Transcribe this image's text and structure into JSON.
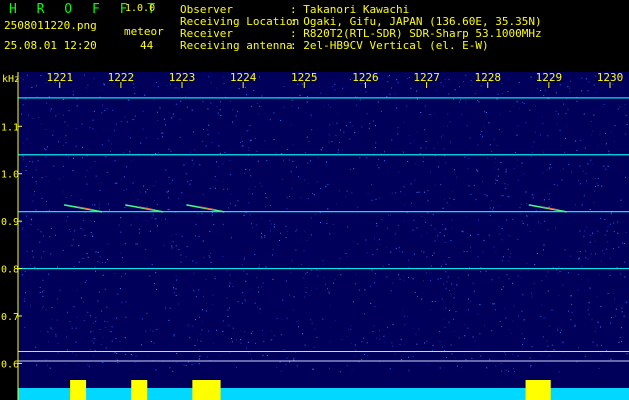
{
  "header": {
    "app_name": "H R O F F T",
    "version": "1.0.0",
    "filename": "2508011220.png",
    "datetime": "25.08.01 12:20",
    "meteor_label": "meteor",
    "meteor_count": "44",
    "info_labels": [
      "Observer",
      "Receiving Location",
      "Receiver",
      "Receiving antenna"
    ],
    "info_values": [
      ": Takanori Kawachi",
      ": Ogaki, Gifu, JAPAN (136.60E, 35.35N)",
      ": R820T2(RTL-SDR) SDR-Sharp 53.1000MHz",
      ": 2el-HB9CV Vertical (el. E-W)"
    ]
  },
  "colors": {
    "logo": "#00ff00",
    "version": "#ffff00",
    "text": "#ffff00",
    "background": "#00005a",
    "line_cyan": "#00ffff",
    "level_bar": "#00d8ff",
    "level_peak": "#ffff00"
  },
  "chart_data": {
    "type": "heatmap",
    "ylabel": "kHz",
    "x_ticks": [
      "1221",
      "1222",
      "1223",
      "1224",
      "1225",
      "1226",
      "1227",
      "1228",
      "1229",
      "1230"
    ],
    "y_ticks": [
      "1.1",
      "1.0",
      "0.9",
      "0.8",
      "0.7",
      "0.6"
    ],
    "carrier_lines_khz": [
      1.16,
      1.04,
      0.92,
      0.8
    ],
    "meteor_echo_minutes": [
      1221.3,
      1222.3,
      1223.3,
      1228.9
    ]
  }
}
